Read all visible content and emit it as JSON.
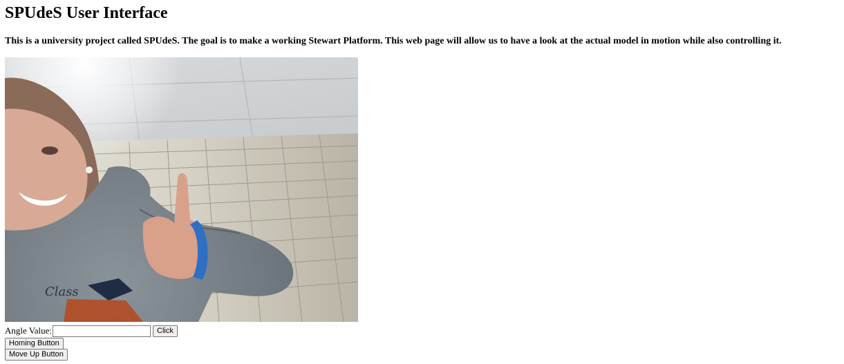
{
  "page": {
    "title": "SPUdeS User Interface",
    "description": "This is a university project called SPUdeS. The goal is to make a working Stewart Platform. This web page will allow us to have a look at the actual model in motion while also controlling it."
  },
  "video_feed": {
    "content": "webcam frame: person in grey hoodie giving thumbs up in a tiled room"
  },
  "controls": {
    "angle_label": "Angle Value:",
    "angle_value": "",
    "click_label": "Click",
    "homing_label": "Homing Button",
    "move_up_label": "Move Up Button"
  }
}
